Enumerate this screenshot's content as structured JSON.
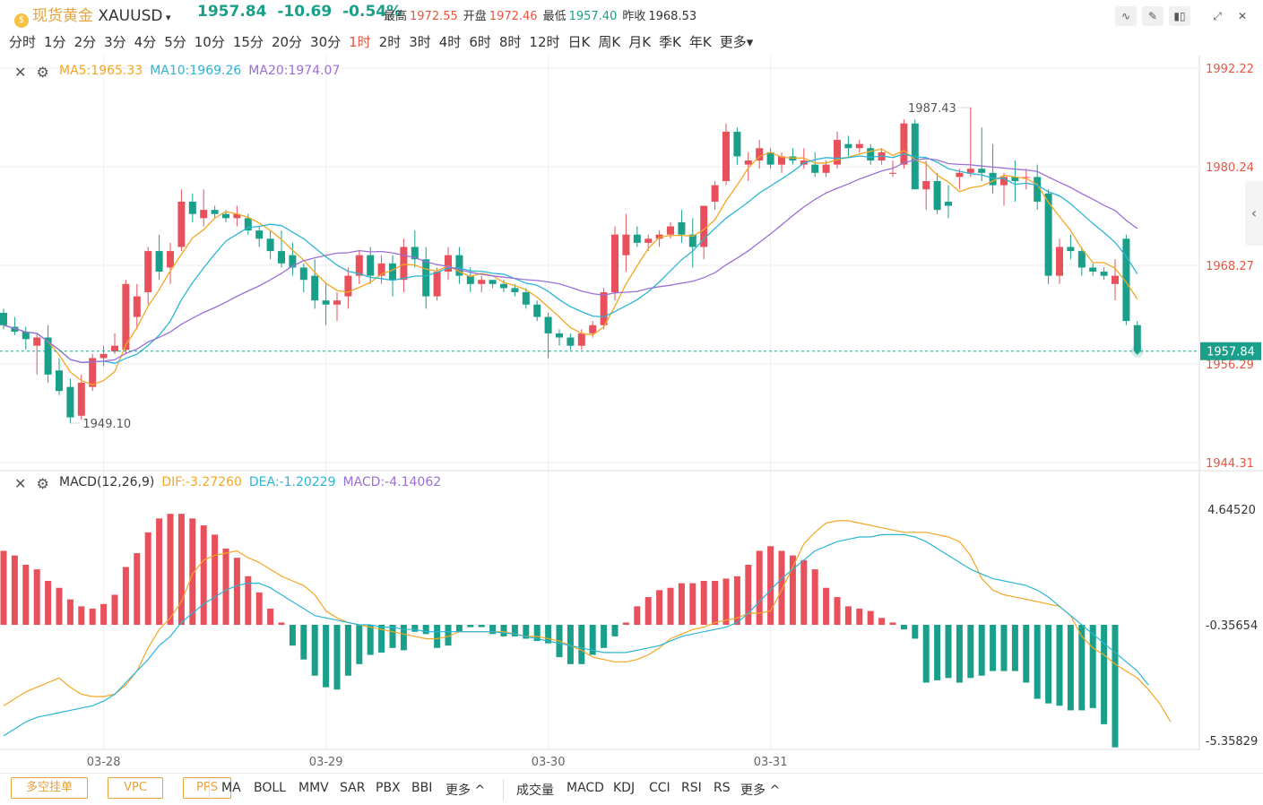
{
  "header": {
    "coin_glyph": "$",
    "name": "现货黄金",
    "symbol": "XAUUSD",
    "price": "1957.84",
    "change": "-10.69",
    "change_pct": "-0.54%",
    "stats": [
      {
        "label": "最高",
        "value": "1972.55",
        "color": "#e8553f"
      },
      {
        "label": "开盘",
        "value": "1972.46",
        "color": "#e8553f"
      },
      {
        "label": "最低",
        "value": "1957.40",
        "color": "#1aa08a"
      },
      {
        "label": "昨收",
        "value": "1968.53",
        "color": "#333333"
      }
    ],
    "tools": [
      {
        "name": "line-chart-icon",
        "glyph": "∿"
      },
      {
        "name": "draw-icon",
        "glyph": "✎"
      },
      {
        "name": "candlestick-icon",
        "glyph": "▮▯"
      },
      {
        "name": "fullscreen-icon",
        "glyph": "⤢"
      },
      {
        "name": "close-icon",
        "glyph": "✕"
      }
    ]
  },
  "intervals": [
    "分时",
    "1分",
    "2分",
    "3分",
    "4分",
    "5分",
    "10分",
    "15分",
    "20分",
    "30分",
    "1时",
    "2时",
    "3时",
    "4时",
    "6时",
    "8时",
    "12时",
    "日K",
    "周K",
    "月K",
    "季K",
    "年K",
    "更多▾"
  ],
  "active_interval": "1时",
  "main_legend": [
    {
      "text": "MA5:1965.33",
      "color": "#f5a623"
    },
    {
      "text": "MA10:1969.26",
      "color": "#2bb5d6"
    },
    {
      "text": "MA20:1974.07",
      "color": "#9c6fd6"
    }
  ],
  "macd_legend": [
    {
      "text": "MACD(12,26,9)",
      "color": "#333333"
    },
    {
      "text": "DIF:-3.27260",
      "color": "#f5a623"
    },
    {
      "text": "DEA:-1.20229",
      "color": "#2bb5d6"
    },
    {
      "text": "MACD:-4.14062",
      "color": "#9c6fd6"
    }
  ],
  "panel_controls": {
    "close": "✕",
    "settings": "⚙"
  },
  "side_tab": "‹",
  "footer": {
    "buttons": [
      "多空挂单",
      "VPC",
      "PPS"
    ],
    "main_indicators": [
      "MA",
      "BOLL",
      "MMV",
      "SAR",
      "PBX",
      "BBI",
      "更多 ^"
    ],
    "sub_indicators": [
      "成交量",
      "MACD",
      "KDJ",
      "CCI",
      "RSI",
      "RS",
      "更多 ^"
    ]
  },
  "colors": {
    "up": "#e8505b",
    "down": "#1aa08a",
    "ma5": "#f5a623",
    "ma10": "#2bb5d6",
    "ma20": "#9c6fd6",
    "grid": "#eeeeee"
  },
  "chart_data": [
    {
      "type": "candlestick",
      "y_axis_ticks": [
        "1992.22",
        "1980.24",
        "1968.27",
        "1956.29",
        "1944.31"
      ],
      "ylim": [
        1944.31,
        1992.22
      ],
      "x_ticks": [
        "03-28",
        "03-29",
        "03-30",
        "03-31"
      ],
      "last_price_label": "1957.84",
      "max_annotation": {
        "text": "1987.43",
        "value": 1987.43
      },
      "min_annotation": {
        "text": "1949.10",
        "value": 1949.1
      },
      "ohlc": [
        [
          1962.5,
          1963.0,
          1960.5,
          1961.0
        ],
        [
          1960.8,
          1962.0,
          1959.8,
          1960.2
        ],
        [
          1960.2,
          1960.8,
          1958.0,
          1959.3
        ],
        [
          1958.5,
          1960.0,
          1955.0,
          1959.5
        ],
        [
          1959.5,
          1961.0,
          1954.0,
          1955.0
        ],
        [
          1955.5,
          1957.0,
          1952.5,
          1953.0
        ],
        [
          1953.5,
          1954.5,
          1949.1,
          1949.8
        ],
        [
          1950.0,
          1955.0,
          1949.5,
          1954.0
        ],
        [
          1953.5,
          1957.5,
          1953.0,
          1957.0
        ],
        [
          1957.0,
          1958.5,
          1956.0,
          1957.5
        ],
        [
          1957.8,
          1960.0,
          1957.5,
          1958.5
        ],
        [
          1958.0,
          1966.5,
          1957.5,
          1966.0
        ],
        [
          1962.0,
          1966.0,
          1960.5,
          1964.5
        ],
        [
          1965.0,
          1970.5,
          1963.5,
          1970.0
        ],
        [
          1970.0,
          1972.0,
          1966.5,
          1967.5
        ],
        [
          1968.0,
          1971.0,
          1966.0,
          1970.0
        ],
        [
          1970.5,
          1977.5,
          1970.0,
          1976.0
        ],
        [
          1976.0,
          1977.0,
          1973.5,
          1974.5
        ],
        [
          1974.0,
          1977.5,
          1973.0,
          1975.0
        ],
        [
          1975.0,
          1975.5,
          1974.0,
          1974.5
        ],
        [
          1974.5,
          1975.0,
          1973.5,
          1974.0
        ],
        [
          1974.0,
          1975.5,
          1973.0,
          1974.5
        ],
        [
          1974.0,
          1974.5,
          1972.0,
          1972.5
        ],
        [
          1972.5,
          1973.0,
          1970.5,
          1971.5
        ],
        [
          1971.5,
          1972.5,
          1969.0,
          1970.0
        ],
        [
          1970.0,
          1972.5,
          1968.0,
          1968.5
        ],
        [
          1969.5,
          1971.0,
          1967.0,
          1968.0
        ],
        [
          1968.0,
          1968.5,
          1965.0,
          1966.5
        ],
        [
          1967.0,
          1969.0,
          1963.0,
          1964.0
        ],
        [
          1964.0,
          1966.0,
          1961.0,
          1963.5
        ],
        [
          1963.5,
          1965.0,
          1961.5,
          1964.0
        ],
        [
          1964.5,
          1968.0,
          1963.0,
          1967.0
        ],
        [
          1967.0,
          1970.0,
          1966.0,
          1969.5
        ],
        [
          1969.5,
          1970.5,
          1966.0,
          1967.0
        ],
        [
          1967.0,
          1969.5,
          1966.0,
          1968.5
        ],
        [
          1968.5,
          1969.5,
          1964.5,
          1966.5
        ],
        [
          1966.5,
          1971.5,
          1965.0,
          1970.5
        ],
        [
          1970.5,
          1972.5,
          1968.0,
          1969.0
        ],
        [
          1969.0,
          1970.5,
          1963.0,
          1964.5
        ],
        [
          1964.5,
          1968.0,
          1964.0,
          1967.5
        ],
        [
          1967.5,
          1970.5,
          1966.5,
          1969.5
        ],
        [
          1969.5,
          1970.5,
          1966.0,
          1967.0
        ],
        [
          1967.0,
          1968.0,
          1965.0,
          1966.0
        ],
        [
          1966.0,
          1967.0,
          1965.0,
          1966.5
        ],
        [
          1966.5,
          1966.5,
          1965.5,
          1966.0
        ],
        [
          1966.0,
          1966.5,
          1965.0,
          1965.5
        ],
        [
          1965.5,
          1966.0,
          1964.5,
          1965.0
        ],
        [
          1965.0,
          1965.5,
          1963.0,
          1963.5
        ],
        [
          1963.5,
          1964.0,
          1961.5,
          1962.0
        ],
        [
          1962.0,
          1962.5,
          1957.0,
          1960.0
        ],
        [
          1960.0,
          1960.5,
          1958.5,
          1959.5
        ],
        [
          1959.5,
          1960.0,
          1958.0,
          1958.5
        ],
        [
          1958.5,
          1960.5,
          1958.0,
          1960.0
        ],
        [
          1960.0,
          1961.5,
          1959.5,
          1961.0
        ],
        [
          1961.0,
          1965.5,
          1960.5,
          1965.0
        ],
        [
          1965.0,
          1973.0,
          1964.0,
          1972.0
        ],
        [
          1969.5,
          1974.5,
          1967.5,
          1972.0
        ],
        [
          1972.0,
          1973.0,
          1970.5,
          1971.0
        ],
        [
          1971.0,
          1972.0,
          1970.0,
          1971.5
        ],
        [
          1971.5,
          1972.5,
          1970.5,
          1972.0
        ],
        [
          1972.0,
          1973.5,
          1971.5,
          1973.0
        ],
        [
          1973.5,
          1975.0,
          1971.0,
          1972.0
        ],
        [
          1972.0,
          1974.0,
          1968.0,
          1970.5
        ],
        [
          1970.5,
          1975.0,
          1969.0,
          1975.5
        ],
        [
          1976.0,
          1978.5,
          1975.0,
          1978.0
        ],
        [
          1978.5,
          1985.5,
          1978.0,
          1984.5
        ],
        [
          1984.5,
          1985.0,
          1980.5,
          1981.5
        ],
        [
          1980.5,
          1982.0,
          1978.5,
          1981.0
        ],
        [
          1981.0,
          1983.5,
          1980.0,
          1982.5
        ],
        [
          1982.0,
          1982.5,
          1980.0,
          1980.5
        ],
        [
          1980.5,
          1982.0,
          1979.5,
          1981.5
        ],
        [
          1981.5,
          1982.5,
          1980.5,
          1981.0
        ],
        [
          1980.5,
          1982.5,
          1980.0,
          1981.0
        ],
        [
          1980.5,
          1982.0,
          1979.0,
          1979.5
        ],
        [
          1979.5,
          1981.0,
          1979.0,
          1980.5
        ],
        [
          1980.5,
          1984.5,
          1980.0,
          1983.5
        ],
        [
          1983.0,
          1984.0,
          1981.5,
          1982.5
        ],
        [
          1982.5,
          1983.5,
          1982.0,
          1983.0
        ],
        [
          1982.5,
          1983.0,
          1980.5,
          1981.0
        ],
        [
          1981.0,
          1982.5,
          1980.5,
          1982.0
        ],
        [
          1979.5,
          1981.0,
          1979.0,
          1979.5
        ],
        [
          1980.5,
          1986.0,
          1980.0,
          1985.5
        ],
        [
          1985.5,
          1986.0,
          1977.5,
          1977.5
        ],
        [
          1977.5,
          1981.0,
          1975.0,
          1978.5
        ],
        [
          1978.5,
          1979.5,
          1974.5,
          1975.0
        ],
        [
          1976.0,
          1978.0,
          1974.0,
          1975.5
        ],
        [
          1979.0,
          1980.0,
          1977.5,
          1979.5
        ],
        [
          1979.5,
          1987.43,
          1979.0,
          1980.0
        ],
        [
          1980.0,
          1985.0,
          1978.5,
          1979.5
        ],
        [
          1979.5,
          1983.0,
          1977.0,
          1978.0
        ],
        [
          1978.0,
          1979.5,
          1975.5,
          1979.0
        ],
        [
          1979.0,
          1981.0,
          1976.0,
          1978.5
        ],
        [
          1979.0,
          1980.0,
          1977.5,
          1979.0
        ],
        [
          1979.0,
          1980.5,
          1975.0,
          1976.0
        ],
        [
          1977.0,
          1977.5,
          1966.0,
          1967.0
        ],
        [
          1967.0,
          1971.5,
          1966.0,
          1970.5
        ],
        [
          1970.5,
          1972.0,
          1969.0,
          1970.0
        ],
        [
          1970.0,
          1970.5,
          1967.0,
          1968.0
        ],
        [
          1968.0,
          1968.5,
          1967.0,
          1967.5
        ],
        [
          1967.5,
          1968.0,
          1966.5,
          1967.0
        ],
        [
          1966.0,
          1969.0,
          1964.0,
          1967.0
        ],
        [
          1971.5,
          1972.0,
          1961.0,
          1961.5
        ],
        [
          1961.0,
          1961.5,
          1957.4,
          1957.84
        ]
      ]
    },
    {
      "type": "macd",
      "y_axis_ticks": [
        "4.64520",
        "-0.35654",
        "-5.35829"
      ],
      "ylim": [
        -5.35829,
        4.6452
      ],
      "series": [
        {
          "name": "DIF",
          "values": [
            -3.5,
            -3.2,
            -2.9,
            -2.7,
            -2.5,
            -2.3,
            -2.7,
            -3.0,
            -3.1,
            -3.1,
            -3.0,
            -2.6,
            -2.0,
            -1.0,
            -0.2,
            0.3,
            1.0,
            2.2,
            2.8,
            3.0,
            3.1,
            3.2,
            2.9,
            2.7,
            2.4,
            2.1,
            1.9,
            1.7,
            1.3,
            0.6,
            0.3,
            0.1,
            0.0,
            -0.1,
            -0.2,
            -0.3,
            -0.4,
            -0.5,
            -0.6,
            -0.6,
            -0.5,
            -0.3,
            -0.3,
            -0.3,
            -0.3,
            -0.3,
            -0.4,
            -0.5,
            -0.5,
            -0.6,
            -0.7,
            -0.9,
            -1.1,
            -1.4,
            -1.5,
            -1.6,
            -1.6,
            -1.5,
            -1.3,
            -1.0,
            -0.6,
            -0.4,
            -0.2,
            -0.1,
            0.1,
            0.2,
            0.3,
            0.5,
            0.5,
            0.6,
            1.5,
            2.5,
            3.5,
            4.0,
            4.4,
            4.5,
            4.5,
            4.4,
            4.3,
            4.2,
            4.1,
            4.0,
            4.0,
            4.0,
            3.9,
            3.8,
            3.6,
            3.0,
            2.0,
            1.5,
            1.3,
            1.2,
            1.1,
            1.0,
            0.9,
            0.8,
            0.4,
            -0.5,
            -1.0,
            -1.3,
            -1.7,
            -2.0,
            -2.3,
            -2.8,
            -3.4,
            -4.2
          ]
        },
        {
          "name": "DEA",
          "values": [
            -4.8,
            -4.5,
            -4.2,
            -4.0,
            -3.9,
            -3.8,
            -3.7,
            -3.6,
            -3.5,
            -3.3,
            -3.0,
            -2.5,
            -2.0,
            -1.5,
            -0.9,
            -0.5,
            0.1,
            0.5,
            0.9,
            1.2,
            1.5,
            1.7,
            1.8,
            1.8,
            1.6,
            1.3,
            1.0,
            0.7,
            0.4,
            0.3,
            0.2,
            0.1,
            0.0,
            0.0,
            -0.1,
            -0.1,
            -0.2,
            -0.2,
            -0.3,
            -0.3,
            -0.3,
            -0.3,
            -0.3,
            -0.3,
            -0.3,
            -0.35,
            -0.4,
            -0.5,
            -0.6,
            -0.7,
            -0.8,
            -0.9,
            -1.0,
            -1.1,
            -1.2,
            -1.2,
            -1.2,
            -1.1,
            -1.0,
            -0.9,
            -0.7,
            -0.5,
            -0.4,
            -0.3,
            -0.2,
            -0.1,
            0.1,
            0.5,
            1.0,
            1.5,
            2.0,
            2.4,
            2.8,
            3.2,
            3.4,
            3.6,
            3.7,
            3.8,
            3.8,
            3.9,
            3.9,
            3.9,
            3.8,
            3.6,
            3.3,
            3.0,
            2.7,
            2.4,
            2.2,
            2.0,
            1.9,
            1.8,
            1.7,
            1.5,
            1.2,
            0.8,
            0.4,
            0.0,
            -0.4,
            -0.8,
            -1.2,
            -1.6,
            -2.0,
            -2.6
          ]
        },
        {
          "name": "MACD",
          "values": [
            3.2,
            3.0,
            2.6,
            2.4,
            1.9,
            1.6,
            1.1,
            0.8,
            0.7,
            0.9,
            1.3,
            2.5,
            3.1,
            4.0,
            4.6,
            4.8,
            4.8,
            4.6,
            4.3,
            3.9,
            3.3,
            2.9,
            2.1,
            1.4,
            0.7,
            0.1,
            -0.9,
            -1.5,
            -2.2,
            -2.7,
            -2.8,
            -2.2,
            -1.7,
            -1.3,
            -1.2,
            -1.0,
            -1.1,
            -0.3,
            -0.4,
            -1.0,
            -0.9,
            -0.3,
            -0.1,
            -0.1,
            -0.4,
            -0.5,
            -0.5,
            -0.6,
            -0.7,
            -0.8,
            -1.4,
            -1.7,
            -1.7,
            -1.3,
            -1.0,
            -0.5,
            0.1,
            0.8,
            1.2,
            1.5,
            1.6,
            1.8,
            1.8,
            1.9,
            1.9,
            2.0,
            2.1,
            2.6,
            3.2,
            3.4,
            3.2,
            3.0,
            2.8,
            2.4,
            1.6,
            1.2,
            0.8,
            0.7,
            0.6,
            0.3,
            0.1,
            -0.2,
            -0.6,
            -2.5,
            -2.4,
            -2.3,
            -2.5,
            -2.3,
            -2.2,
            -2.0,
            -2.0,
            -2.0,
            -2.5,
            -3.2,
            -3.4,
            -3.5,
            -3.7,
            -3.7,
            -3.6,
            -4.3,
            -5.3
          ]
        }
      ]
    }
  ]
}
